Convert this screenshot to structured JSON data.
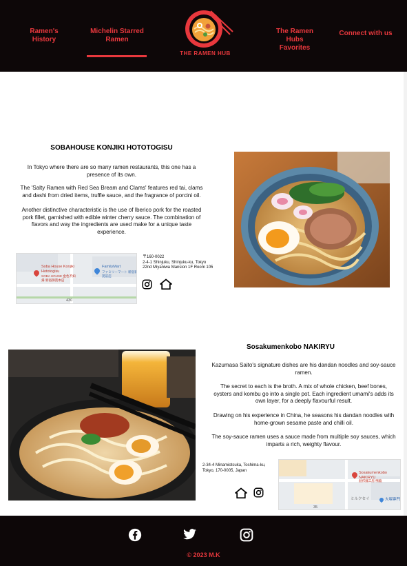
{
  "header": {
    "nav": {
      "history": "Ramen's History",
      "michelin": "Michelin Starred Ramen",
      "favorites": "The Ramen Hubs Favorites",
      "connect": "Connect with us"
    },
    "logo_text": "THE RAMEN HUB",
    "active_tab": "michelin"
  },
  "restaurants": [
    {
      "title": "SOBAHOUSE KONJIKI HOTOTOGISU",
      "paragraphs": [
        "In Tokyo where there are so many ramen restaurants, this one has a presence of its own.",
        "The 'Salty Ramen with Red Sea Bream and Clams' features red tai, clams and dashi from dried items, truffle sauce, and the fragrance of porcini oil.",
        "Another distinctive characteristic is the use of Iberico pork for the roasted pork fillet, garnished with edible winter cherry sauce. The combination of flavors and way the ingredients are used make for a unique taste experience."
      ],
      "address": "〒160-0022\n2-4-1 Shinjuku, Shinjuku-ku, Tokyo 22nd Miyaniwa Mansion 1F Room 105",
      "map": {
        "pin_label": "Soba House Konjiki Hototogisu",
        "pin_sublabel": "SOBA HOUSE 金色不如帰 新宿御苑本店",
        "poi_label": "FamilyMart",
        "poi_sublabel": "ファミリーマート 新宿御苑前店",
        "route": "430"
      }
    },
    {
      "title": "Sosakumenkobo NAKIRYU",
      "paragraphs": [
        "Kazumasa Saito's signature dishes are his dandan noodles and soy-sauce ramen.",
        "The secret to each is the broth. A mix of whole chicken, beef bones, oysters and kombu go into a single pot. Each ingredient umami's adds its own layer, for a deeply flavourful result.",
        "Drawing on his experience in China, he seasons his dandan noodles with home-grown sesame paste and chilli oil.",
        "The soy-sauce ramen uses a sauce made from multiple soy sauces, which imparts a rich, weighty flavour."
      ],
      "address": "2-34-4 Minamiotsuka, Toshima-ku, Tokyo, 170-0005, Japan",
      "map": {
        "pin_label": "Sosakumenkobo NAKIRYU",
        "pin_sublabel": "創作麺工房 鳴龍",
        "poi_label": "ミルクセイ",
        "poi_label2": "大塚専門",
        "route": "35"
      }
    }
  ],
  "icons": {
    "instagram": "instagram-icon",
    "home": "home-icon",
    "facebook": "facebook-icon",
    "twitter": "twitter-icon"
  },
  "footer": {
    "copyright": "© 2023 M.K"
  },
  "colors": {
    "accent": "#e8383d",
    "header_bg": "#0d0708"
  }
}
